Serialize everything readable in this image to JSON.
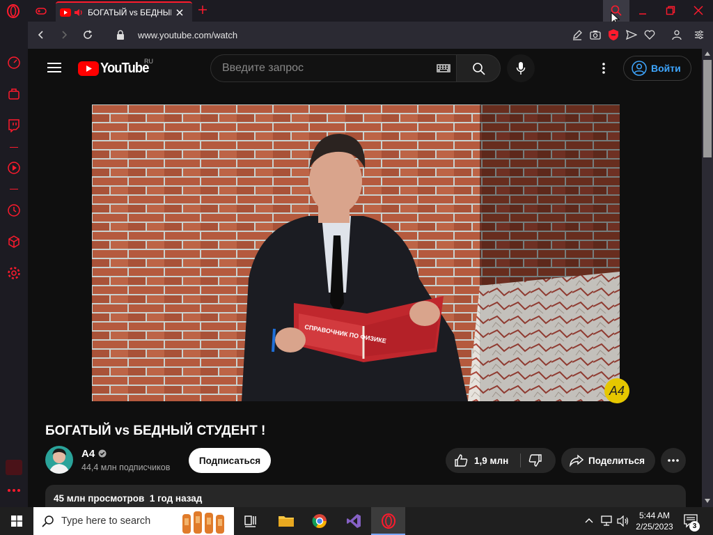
{
  "browser": {
    "tab_title": "БОГАТЫЙ vs БЕДНЫЙ С",
    "url": "www.youtube.com/watch"
  },
  "youtube": {
    "logo_text": "YouTube",
    "logo_region": "RU",
    "search_placeholder": "Введите запрос",
    "signin_label": "Войти",
    "video_title": "БОГАТЫЙ vs БЕДНЫЙ СТУДЕНТ !",
    "watermark": "А4",
    "channel": {
      "name": "А4",
      "subscribers": "44,4 млн подписчиков"
    },
    "subscribe_label": "Подписаться",
    "likes": "1,9 млн",
    "share_label": "Поделиться",
    "stats": "45 млн просмотров  1 год назад",
    "book_text": "СПРАВОЧНИК ПО ФИЗИКЕ"
  },
  "taskbar": {
    "search_placeholder": "Type here to search",
    "time": "5:44 AM",
    "date": "2/25/2023",
    "notification_count": "3"
  },
  "colors": {
    "opera_red": "#ff1b2d",
    "youtube_red": "#ff0000",
    "signin_blue": "#3ea6ff"
  }
}
